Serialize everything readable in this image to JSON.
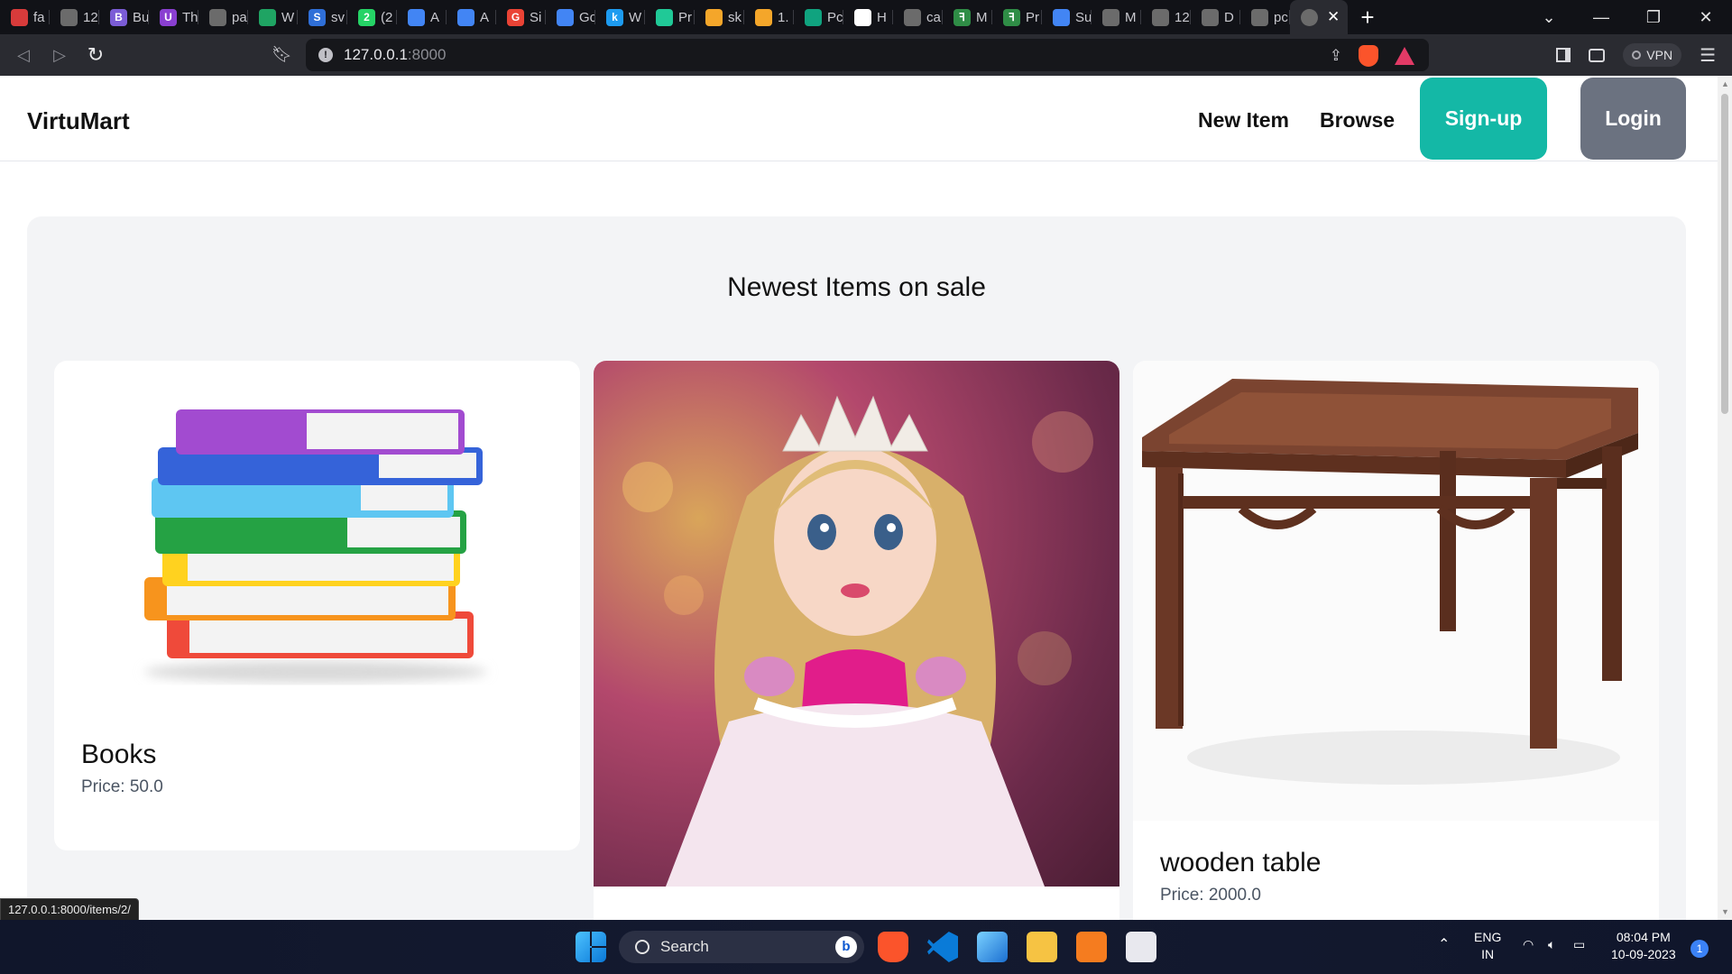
{
  "browser": {
    "tabs": [
      {
        "favicon_color": "#d83b3b",
        "title": "fa"
      },
      {
        "favicon_color": "#6b6b6b",
        "title": "12"
      },
      {
        "favicon_color": "#7b5cd6",
        "title": "Bu",
        "glyph": "B"
      },
      {
        "favicon_color": "#8a3fd1",
        "title": "Th",
        "glyph": "U"
      },
      {
        "favicon_color": "#6b6b6b",
        "title": "pa"
      },
      {
        "favicon_color": "#1fa463",
        "title": "W"
      },
      {
        "favicon_color": "#2f6fd8",
        "title": "sv",
        "glyph": "S"
      },
      {
        "favicon_color": "#25d366",
        "title": "(2",
        "glyph": "2"
      },
      {
        "favicon_color": "#4285f4",
        "title": "A"
      },
      {
        "favicon_color": "#4285f4",
        "title": "A"
      },
      {
        "favicon_color": "#ea4335",
        "title": "Si",
        "glyph": "G"
      },
      {
        "favicon_color": "#4285f4",
        "title": "Go"
      },
      {
        "favicon_color": "#1d9bf0",
        "title": "W",
        "glyph": "k"
      },
      {
        "favicon_color": "#20c997",
        "title": "Pr"
      },
      {
        "favicon_color": "#f4a62a",
        "title": "sk"
      },
      {
        "favicon_color": "#f4a62a",
        "title": "1."
      },
      {
        "favicon_color": "#10a37f",
        "title": "Pc"
      },
      {
        "favicon_color": "#ffffff",
        "title": "H"
      },
      {
        "favicon_color": "#6b6b6b",
        "title": "ca"
      },
      {
        "favicon_color": "#2f8d46",
        "title": "M",
        "glyph": "ꟻ"
      },
      {
        "favicon_color": "#2f8d46",
        "title": "Pr",
        "glyph": "ꟻ"
      },
      {
        "favicon_color": "#4285f4",
        "title": "Su"
      },
      {
        "favicon_color": "#6b6b6b",
        "title": "M"
      },
      {
        "favicon_color": "#6b6b6b",
        "title": "12"
      },
      {
        "favicon_color": "#6b6b6b",
        "title": "D"
      },
      {
        "favicon_color": "#6b6b6b",
        "title": "pc"
      }
    ],
    "url_host": "127.0.0.1",
    "url_port": ":8000",
    "vpn_label": "VPN",
    "status_url": "127.0.0.1:8000/items/2/"
  },
  "site": {
    "brand": "VirtuMart",
    "nav": {
      "new_item": "New Item",
      "browse": "Browse",
      "signup": "Sign-up",
      "login": "Login"
    },
    "section_title": "Newest Items on sale",
    "items": [
      {
        "name": "Books",
        "price": "Price: 50.0"
      },
      {
        "name": "",
        "price": ""
      },
      {
        "name": "wooden table",
        "price": "Price: 2000.0"
      }
    ]
  },
  "taskbar": {
    "search_label": "Search",
    "lang": "ENG",
    "region": "IN",
    "time": "08:04 PM",
    "date": "10-09-2023",
    "notifications": "1"
  },
  "colors": {
    "signup_bg": "#14b8a6",
    "login_bg": "#6b7280",
    "section_bg": "#f3f4f6"
  }
}
